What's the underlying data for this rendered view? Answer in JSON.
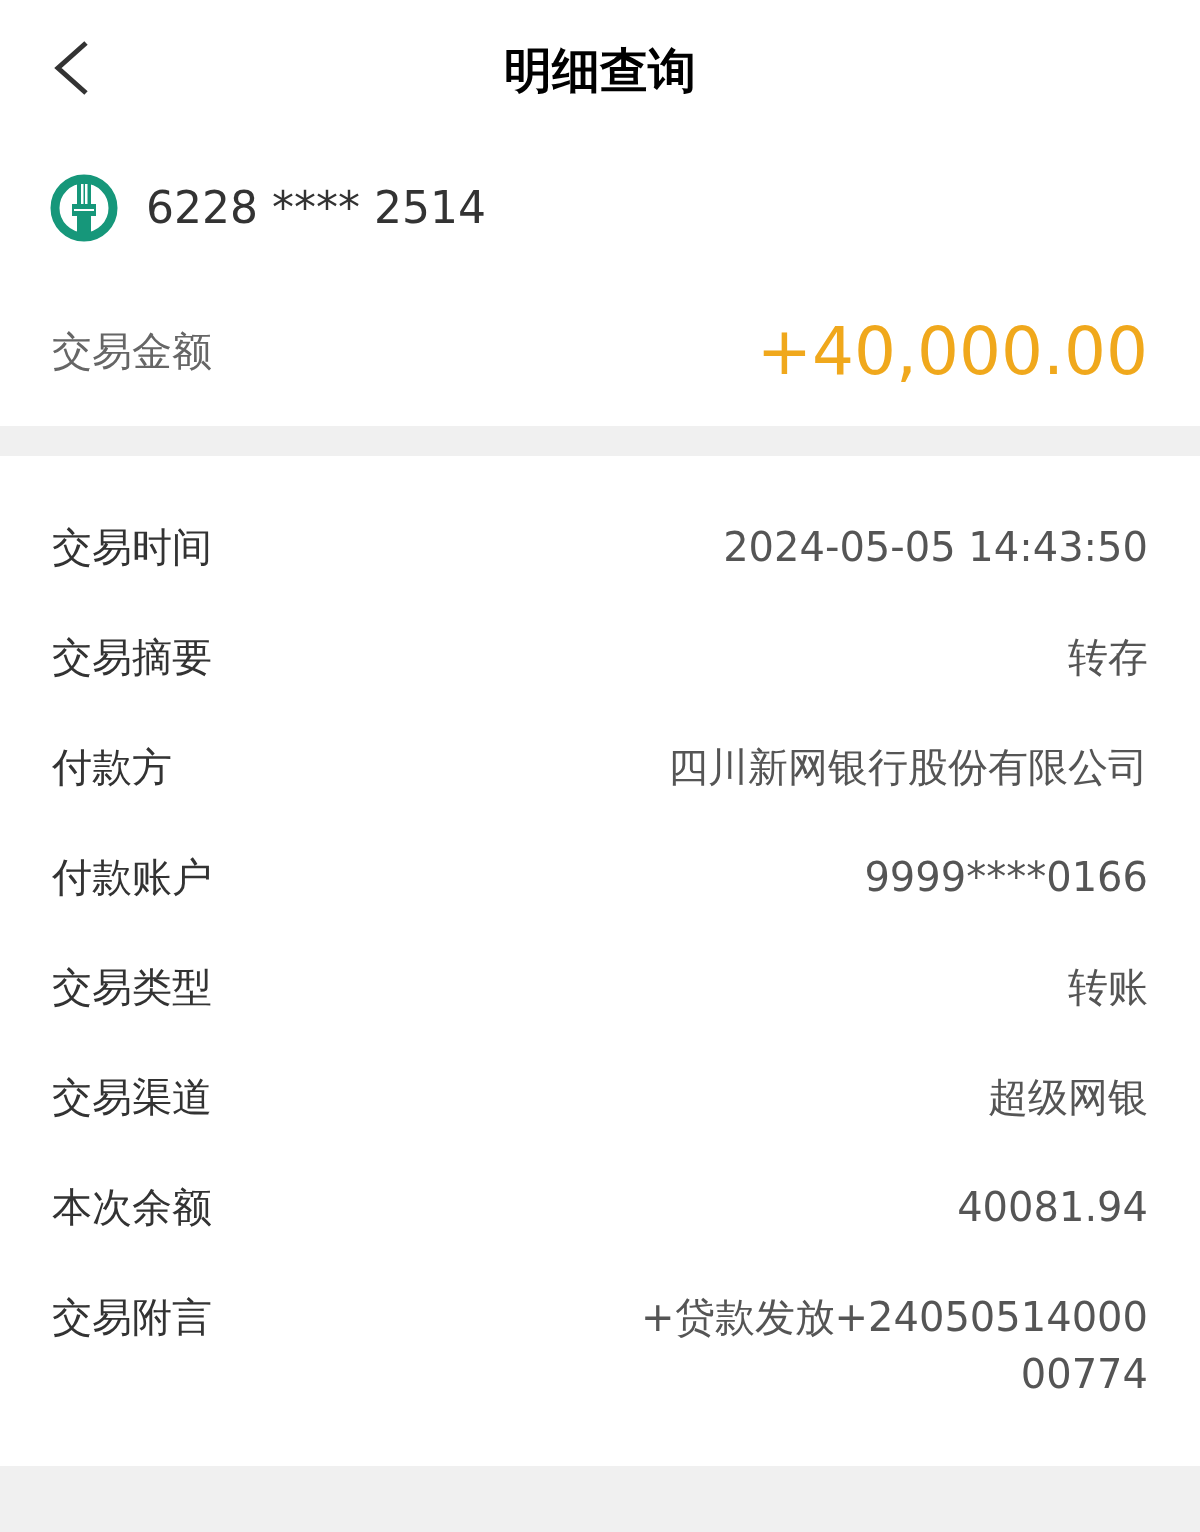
{
  "header": {
    "title": "明细查询"
  },
  "card": {
    "number": "6228 **** 2514"
  },
  "amount": {
    "label": "交易金额",
    "value": "+40,000.00"
  },
  "details": [
    {
      "label": "交易时间",
      "value_lines": [
        "2024-05-05 14:43:50"
      ]
    },
    {
      "label": "交易摘要",
      "value_lines": [
        "转存"
      ]
    },
    {
      "label": "付款方",
      "value_lines": [
        "四川新网银行股份有限公司"
      ]
    },
    {
      "label": "付款账户",
      "value_lines": [
        "9999****0166"
      ]
    },
    {
      "label": "交易类型",
      "value_lines": [
        "转账"
      ]
    },
    {
      "label": "交易渠道",
      "value_lines": [
        "超级网银"
      ]
    },
    {
      "label": "本次余额",
      "value_lines": [
        "40081.94"
      ]
    },
    {
      "label": "交易附言",
      "value_lines": [
        "+贷款发放+24050514000",
        "00774"
      ]
    }
  ]
}
